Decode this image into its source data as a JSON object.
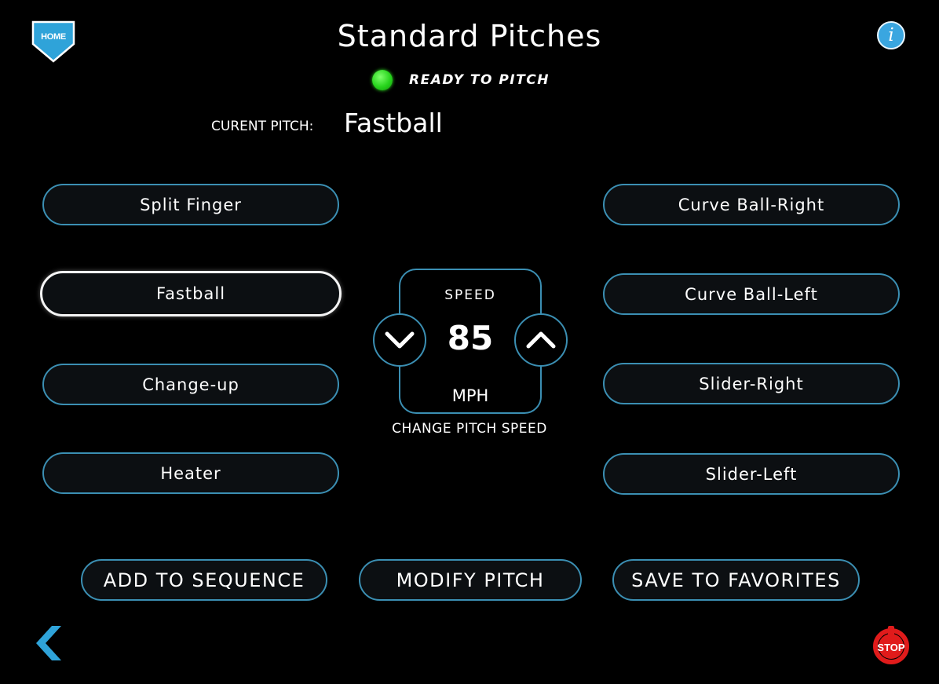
{
  "header": {
    "home_label": "HOME",
    "title": "Standard Pitches",
    "info_icon": "info-icon",
    "status_text": "READY TO PITCH",
    "status_color": "#27d41c"
  },
  "current_pitch": {
    "label": "CURENT PITCH:",
    "value": "Fastball"
  },
  "pitches_left": [
    {
      "label": "Split Finger",
      "selected": false
    },
    {
      "label": "Fastball",
      "selected": true
    },
    {
      "label": "Change-up",
      "selected": false
    },
    {
      "label": "Heater",
      "selected": false
    }
  ],
  "pitches_right": [
    {
      "label": "Curve Ball-Right",
      "selected": false
    },
    {
      "label": "Curve Ball-Left",
      "selected": false
    },
    {
      "label": "Slider-Right",
      "selected": false
    },
    {
      "label": "Slider-Left",
      "selected": false
    }
  ],
  "speed": {
    "label": "SPEED",
    "value": "85",
    "unit": "MPH",
    "caption": "CHANGE PITCH SPEED"
  },
  "actions": {
    "add_to_sequence": "ADD TO SEQUENCE",
    "modify_pitch": "MODIFY PITCH",
    "save_to_favorites": "SAVE TO FAVORITES"
  },
  "footer": {
    "back_icon": "chevron-left-icon",
    "stop_label": "STOP"
  },
  "colors": {
    "accent": "#3b8fb3",
    "background": "#000000",
    "info": "#3aa6e0",
    "stop": "#e01b1b"
  }
}
